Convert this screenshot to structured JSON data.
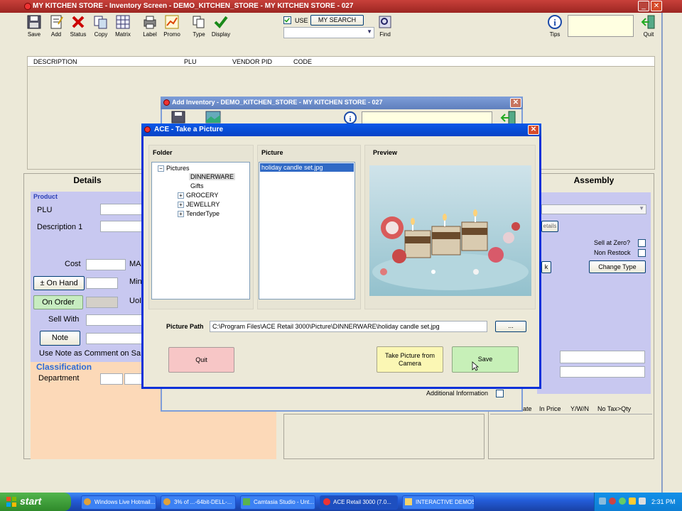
{
  "main_window": {
    "title": "MY KITCHEN STORE  -  Inventory Screen - DEMO_KITCHEN_STORE - MY KITCHEN STORE - 027",
    "toolbar": [
      "Save",
      "Add",
      "Status",
      "Copy",
      "Matrix",
      "Label",
      "Promo",
      "Type",
      "Display"
    ],
    "use_label": "USE",
    "my_search_label": "MY SEARCH",
    "find_label": "Find",
    "tips_label": "Tips",
    "quit_label": "Quit",
    "grid_columns": [
      "DESCRIPTION",
      "PLU",
      "VENDOR PID",
      "CODE"
    ]
  },
  "details": {
    "heading": "Details",
    "product_label": "Product",
    "plu_label": "PLU",
    "description_label": "Description 1",
    "cost_label": "Cost",
    "ma_label": "MA",
    "min_label": "Min",
    "uo_label": "UoI",
    "on_hand_button": "On Hand",
    "on_order_button": "On Order",
    "sell_with_label": "Sell With",
    "note_button": "Note",
    "note_comment_label": "Use Note as Comment on Sa",
    "classification_label": "Classification",
    "department_label": "Department"
  },
  "assembly": {
    "heading": "Assembly",
    "details_button": "etails",
    "sell_at_zero_label": "Sell at Zero?",
    "non_restock_label": "Non Restock",
    "k_button": "k",
    "change_type_button": "Change Type",
    "col_headers": [
      "ate",
      "In Price",
      "Y/W/N",
      "No Tax>Qty"
    ]
  },
  "add_inventory": {
    "title": "Add Inventory - DEMO_KITCHEN_STORE - MY KITCHEN STORE - 027",
    "additional_info_label": "Additional Information"
  },
  "dialog": {
    "title": "ACE - Take a Picture",
    "folder_heading": "Folder",
    "picture_heading": "Picture",
    "preview_heading": "Preview",
    "tree_root": "Pictures",
    "tree_items": [
      {
        "label": "DINNERWARE",
        "selected": true,
        "expandable": false
      },
      {
        "label": "Gifts",
        "selected": false,
        "expandable": false
      },
      {
        "label": "GROCERY",
        "selected": false,
        "expandable": true
      },
      {
        "label": "JEWELLRY",
        "selected": false,
        "expandable": true
      },
      {
        "label": "TenderType",
        "selected": false,
        "expandable": true
      }
    ],
    "picture_items": [
      "holiday candle set.jpg"
    ],
    "picture_path_label": "Picture Path",
    "picture_path_value": "C:\\Program Files\\ACE Retail 3000\\Picture\\DINNERWARE\\holiday candle set.jpg",
    "browse_button": "...",
    "quit_button": "Quit",
    "camera_button": "Take Picture from Camera",
    "save_button": "Save"
  },
  "taskbar": {
    "start_label": "start",
    "tasks": [
      {
        "label": "Windows Live Hotmail...",
        "active": false
      },
      {
        "label": "3% of ...-64bit-DELL-...",
        "active": false
      },
      {
        "label": "Camtasia Studio - Unt...",
        "active": false
      },
      {
        "label": "ACE Retail 3000 (7.0...",
        "active": true
      },
      {
        "label": "INTERACTIVE DEMOS",
        "active": false
      }
    ],
    "clock": "2:31 PM"
  },
  "colors": {
    "details_panel": "#c8c8f0",
    "details_lower": "#fcd9b8",
    "quit_button": "#f7c6c6",
    "camera_button": "#fbf7b4",
    "save_button": "#c7f0b8",
    "selection": "#316ac5"
  }
}
